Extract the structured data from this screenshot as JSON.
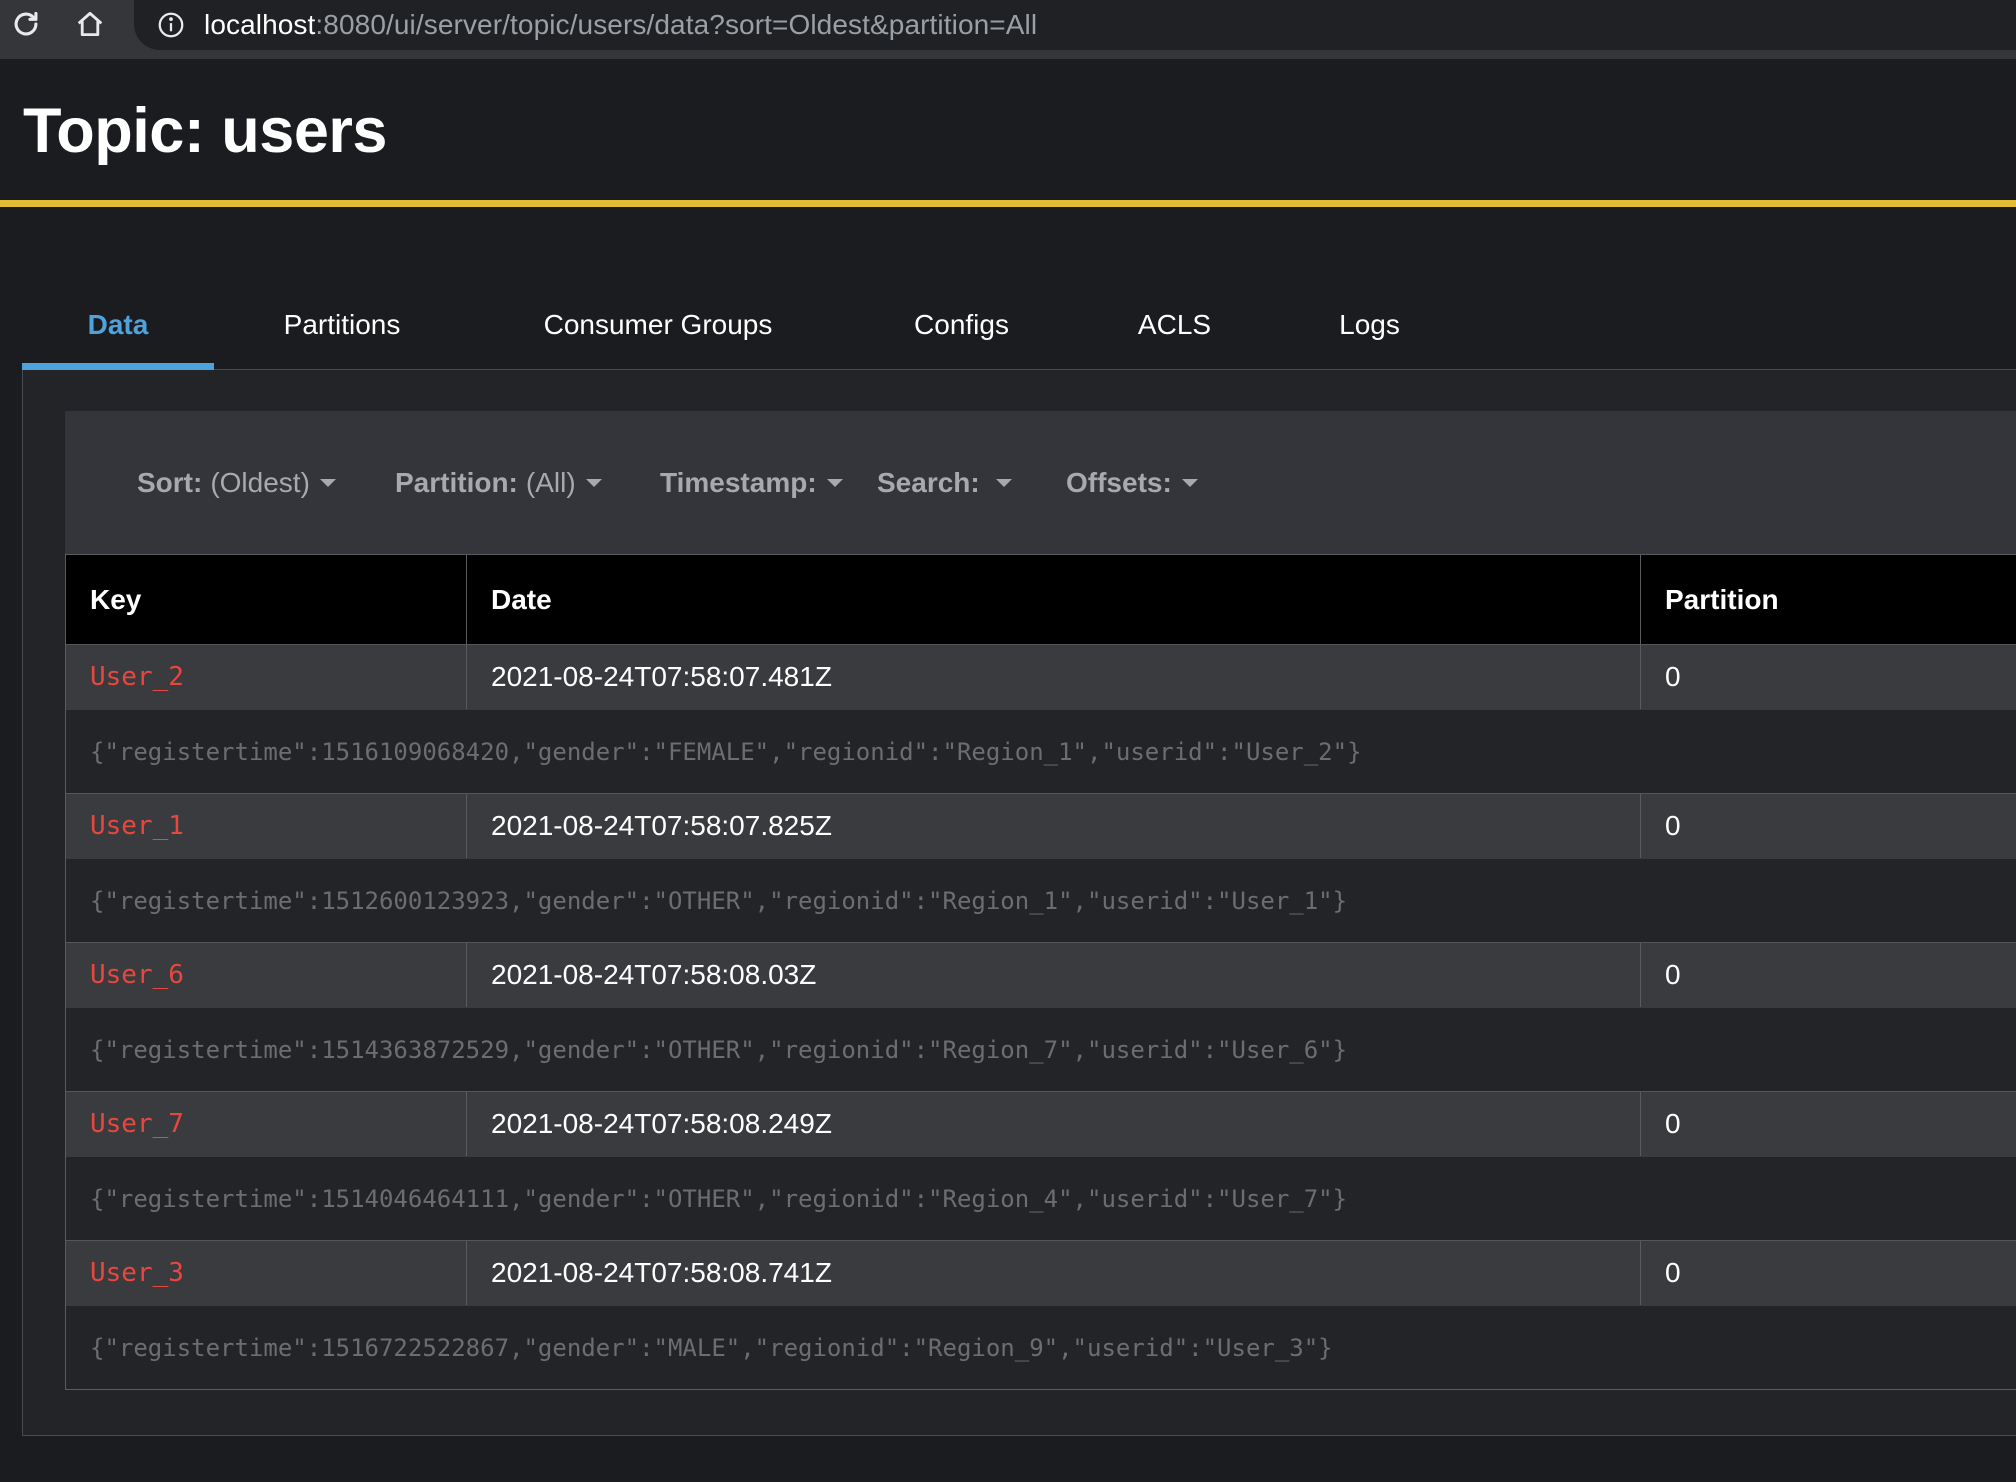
{
  "browser": {
    "url_host": "localhost",
    "url_rest": ":8080/ui/server/topic/users/data?sort=Oldest&partition=All"
  },
  "page": {
    "title": "Topic: users"
  },
  "colors": {
    "accent_rule": "#e2bc36",
    "active_tab": "#4fa3dc",
    "key_text": "#e8473f"
  },
  "tabs": [
    {
      "label": "Data",
      "active": true
    },
    {
      "label": "Partitions",
      "active": false
    },
    {
      "label": "Consumer Groups",
      "active": false
    },
    {
      "label": "Configs",
      "active": false
    },
    {
      "label": "ACLS",
      "active": false
    },
    {
      "label": "Logs",
      "active": false
    }
  ],
  "filters": {
    "sort": {
      "label": "Sort:",
      "value": "(Oldest)"
    },
    "partition": {
      "label": "Partition:",
      "value": "(All)"
    },
    "timestamp": {
      "label": "Timestamp:",
      "value": ""
    },
    "search": {
      "label": "Search:",
      "value": ""
    },
    "offsets": {
      "label": "Offsets:",
      "value": ""
    }
  },
  "table": {
    "columns": [
      "Key",
      "Date",
      "Partition"
    ],
    "rows": [
      {
        "key": "User_2",
        "date": "2021-08-24T07:58:07.481Z",
        "partition": "0",
        "value": "{\"registertime\":1516109068420,\"gender\":\"FEMALE\",\"regionid\":\"Region_1\",\"userid\":\"User_2\"}"
      },
      {
        "key": "User_1",
        "date": "2021-08-24T07:58:07.825Z",
        "partition": "0",
        "value": "{\"registertime\":1512600123923,\"gender\":\"OTHER\",\"regionid\":\"Region_1\",\"userid\":\"User_1\"}"
      },
      {
        "key": "User_6",
        "date": "2021-08-24T07:58:08.03Z",
        "partition": "0",
        "value": "{\"registertime\":1514363872529,\"gender\":\"OTHER\",\"regionid\":\"Region_7\",\"userid\":\"User_6\"}"
      },
      {
        "key": "User_7",
        "date": "2021-08-24T07:58:08.249Z",
        "partition": "0",
        "value": "{\"registertime\":1514046464111,\"gender\":\"OTHER\",\"regionid\":\"Region_4\",\"userid\":\"User_7\"}"
      },
      {
        "key": "User_3",
        "date": "2021-08-24T07:58:08.741Z",
        "partition": "0",
        "value": "{\"registertime\":1516722522867,\"gender\":\"MALE\",\"regionid\":\"Region_9\",\"userid\":\"User_3\"}"
      }
    ]
  }
}
